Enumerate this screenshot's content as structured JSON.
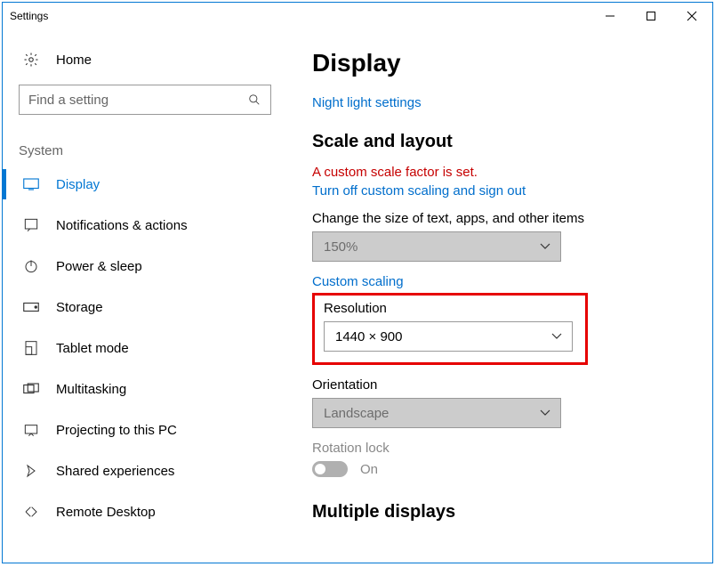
{
  "window": {
    "title": "Settings"
  },
  "sidebar": {
    "home_label": "Home",
    "search_placeholder": "Find a setting",
    "group_label": "System",
    "items": [
      {
        "label": "Display"
      },
      {
        "label": "Notifications & actions"
      },
      {
        "label": "Power & sleep"
      },
      {
        "label": "Storage"
      },
      {
        "label": "Tablet mode"
      },
      {
        "label": "Multitasking"
      },
      {
        "label": "Projecting to this PC"
      },
      {
        "label": "Shared experiences"
      },
      {
        "label": "Remote Desktop"
      }
    ]
  },
  "main": {
    "title": "Display",
    "night_light_link": "Night light settings",
    "scale_layout_header": "Scale and layout",
    "custom_scale_warning": "A custom scale factor is set.",
    "turn_off_scaling_link": "Turn off custom scaling and sign out",
    "text_size_label": "Change the size of text, apps, and other items",
    "text_size_value": "150%",
    "custom_scaling_link": "Custom scaling",
    "resolution_label": "Resolution",
    "resolution_value": "1440 × 900",
    "orientation_label": "Orientation",
    "orientation_value": "Landscape",
    "rotation_lock_label": "Rotation lock",
    "rotation_lock_state": "On",
    "multiple_displays_header": "Multiple displays"
  }
}
